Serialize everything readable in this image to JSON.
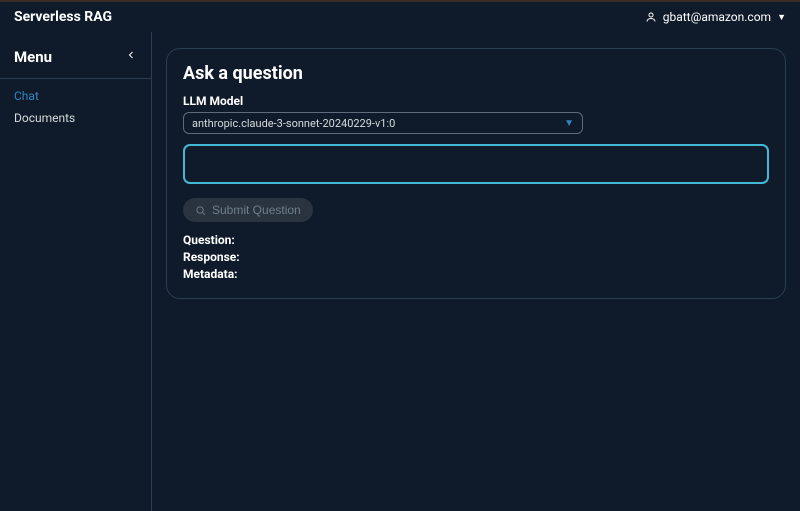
{
  "app": {
    "title": "Serverless RAG"
  },
  "user": {
    "email": "gbatt@amazon.com"
  },
  "sidebar": {
    "menu_label": "Menu",
    "items": [
      {
        "label": "Chat",
        "active": true
      },
      {
        "label": "Documents",
        "active": false
      }
    ]
  },
  "main": {
    "title": "Ask a question",
    "model_label": "LLM Model",
    "model_selected": "anthropic.claude-3-sonnet-20240229-v1:0",
    "question_value": "",
    "submit_label": "Submit Question",
    "result": {
      "question_label": "Question:",
      "response_label": "Response:",
      "metadata_label": "Metadata:"
    }
  }
}
